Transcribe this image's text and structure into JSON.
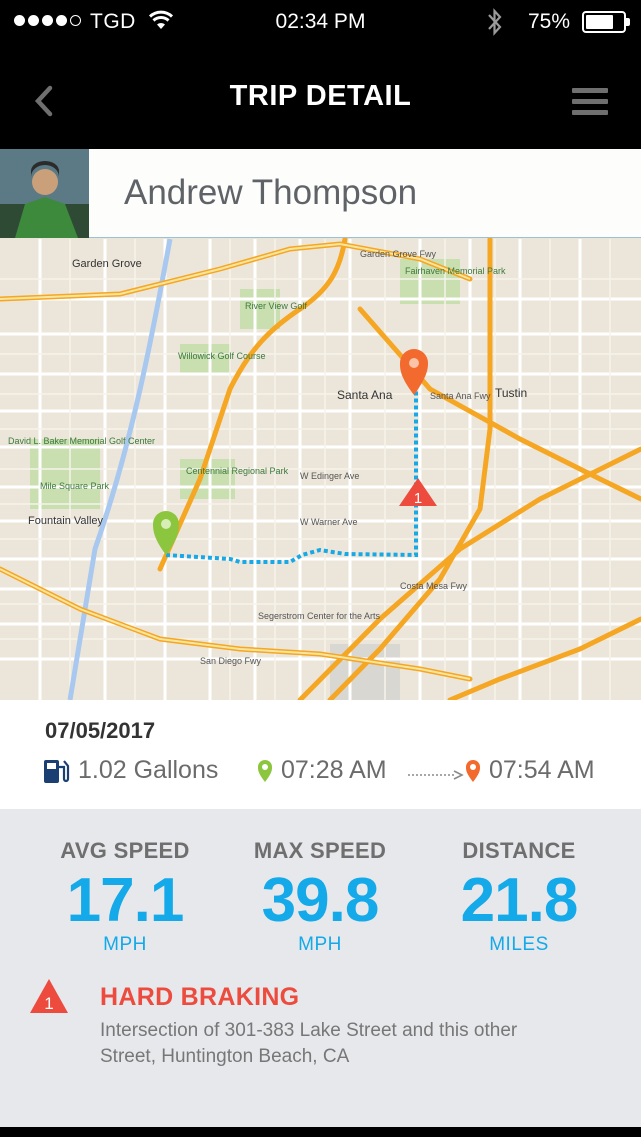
{
  "status_bar": {
    "carrier": "TGD",
    "time": "02:34 PM",
    "battery": "75%",
    "battery_level": 0.75,
    "signal_bars_filled": 4,
    "signal_bars_total": 5
  },
  "nav": {
    "title": "TRIP DETAIL",
    "back_icon": "chevron-left-icon",
    "menu_icon": "hamburger-menu-icon"
  },
  "profile": {
    "name": "Andrew Thompson"
  },
  "map": {
    "labels": {
      "santa_ana": "Santa Ana",
      "tustin": "Tustin",
      "fountain_valley": "Fountain Valley",
      "centennial": "Centennial Regional Park",
      "fairhaven": "Fairhaven Memorial Park",
      "willowick": "Willowick Golf Course",
      "river_view": "River View Golf",
      "garden_grove": "Garden Grove",
      "david_baker": "David L. Baker Memorial Golf Center",
      "mile_square": "Mile Square Park",
      "segerstrom": "Segerstrom Center for the Arts",
      "warner_ave": "W Warner Ave",
      "edinger_ave": "W Edinger Ave",
      "garden_grove_fwy": "Garden Grove Fwy",
      "santa_ana_fwy": "Santa Ana Fwy",
      "san_diego_fwy": "San Diego Fwy",
      "costa_mesa_fwy": "Costa Mesa Fwy"
    },
    "incident_number": "1",
    "colors": {
      "route": "#18a8e6",
      "start_pin": "#8cc63f",
      "end_pin": "#f26a2e",
      "alert": "#ec4b3e",
      "freeway": "#f5a623"
    }
  },
  "trip": {
    "date": "07/05/2017",
    "fuel": "1.02 Gallons",
    "start_time": "07:28 AM",
    "end_time": "07:54 AM"
  },
  "stats": {
    "avg_speed": {
      "label": "AVG SPEED",
      "value": "17.1",
      "unit": "MPH"
    },
    "max_speed": {
      "label": "MAX SPEED",
      "value": "39.8",
      "unit": "MPH"
    },
    "distance": {
      "label": "DISTANCE",
      "value": "21.8",
      "unit": "MILES"
    }
  },
  "alert": {
    "number": "1",
    "title": "HARD BRAKING",
    "description": "Intersection of 301-383 Lake Street and this other Street, Huntington Beach, CA"
  }
}
